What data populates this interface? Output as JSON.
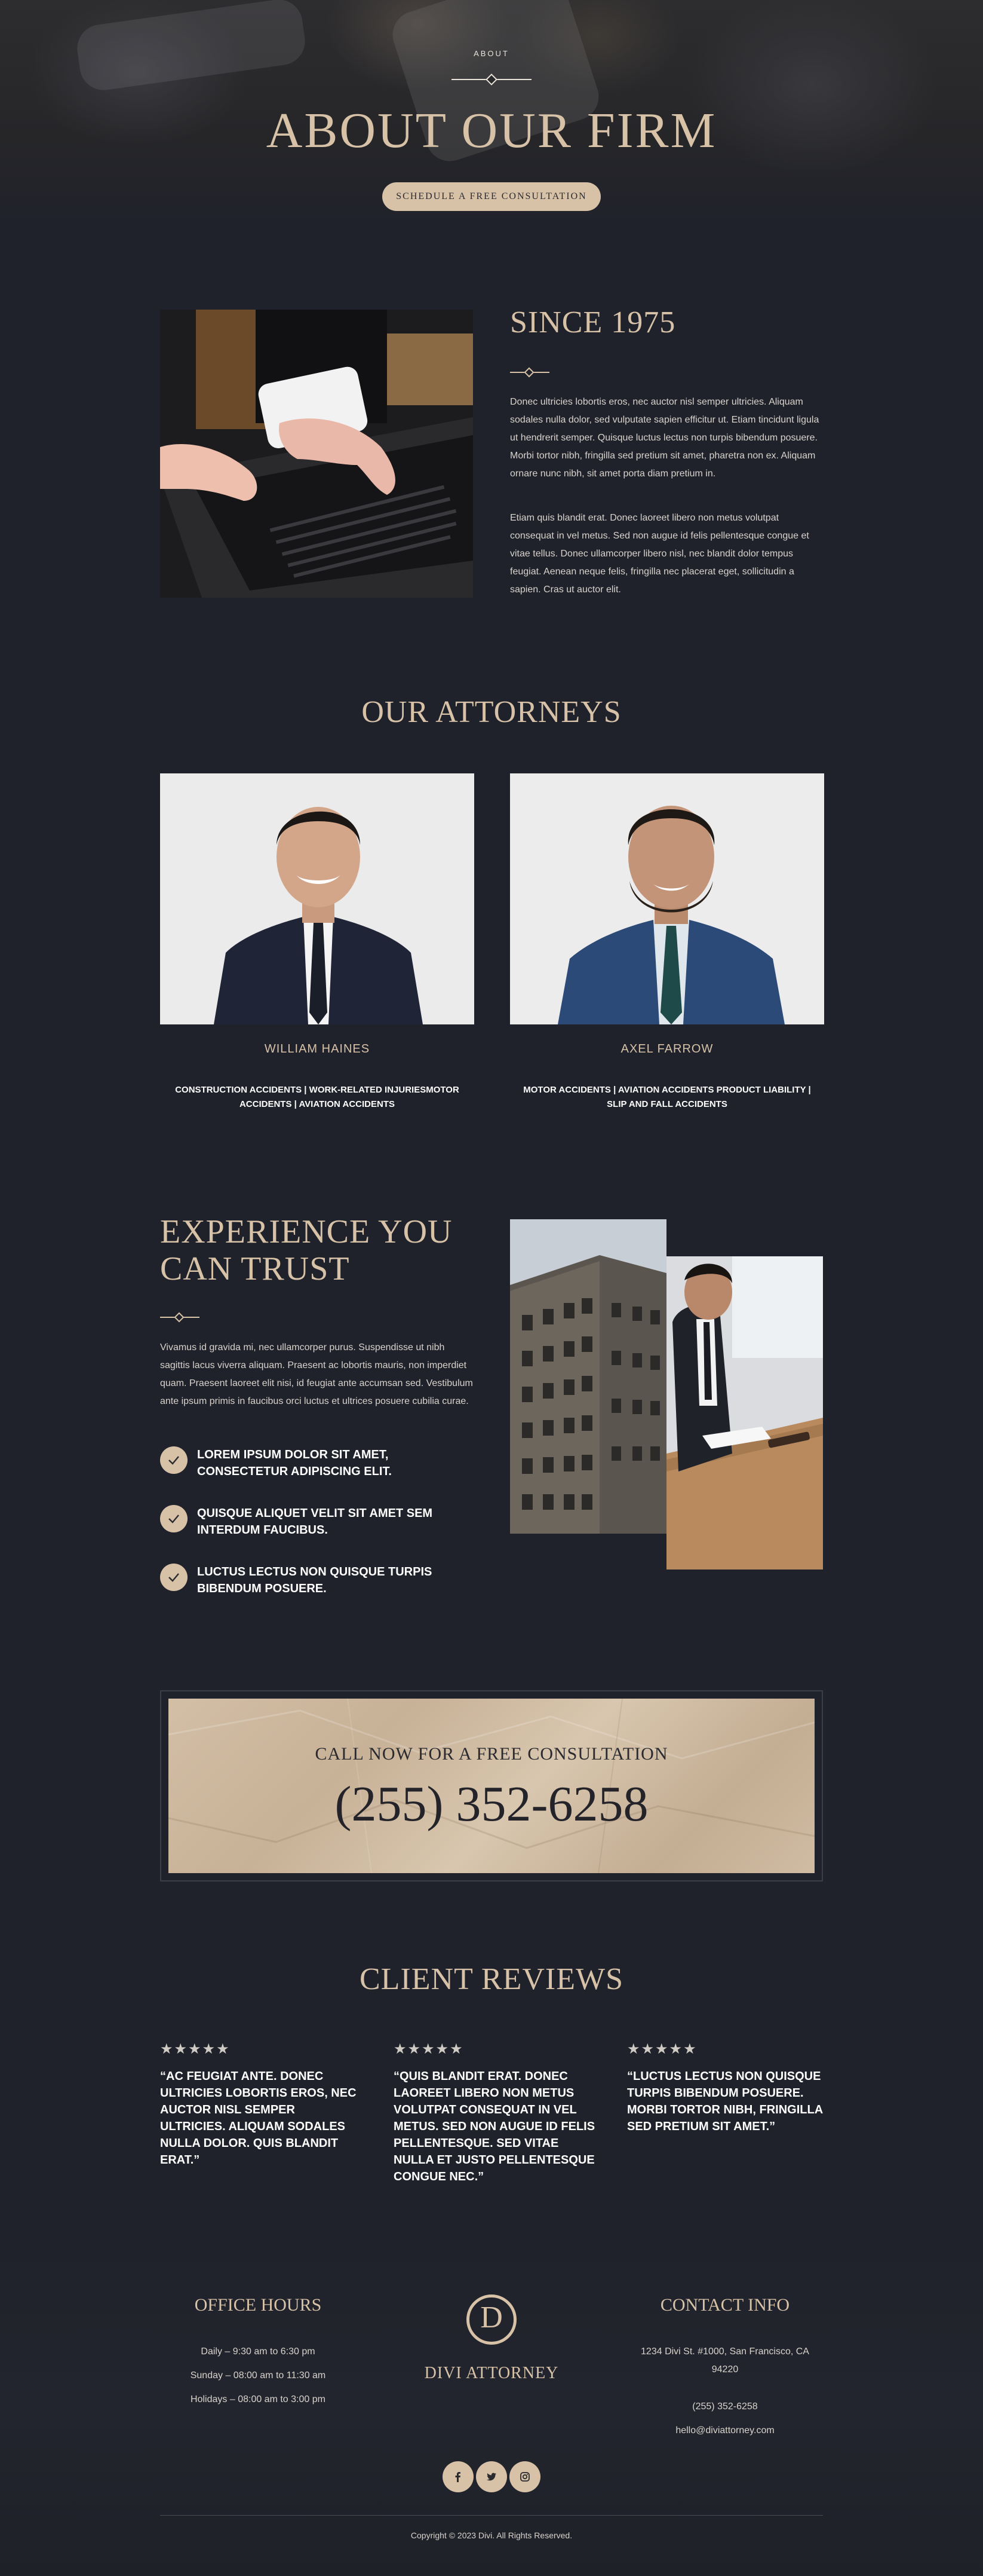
{
  "hero": {
    "eyebrow": "ABOUT",
    "title": "ABOUT OUR FIRM",
    "cta_label": "SCHEDULE A FREE CONSULTATION"
  },
  "since": {
    "title": "SINCE 1975",
    "paragraph1": "Donec ultricies lobortis eros, nec auctor nisl semper ultricies. Aliquam sodales nulla dolor, sed vulputate sapien efficitur ut. Etiam tincidunt ligula ut hendrerit semper. Quisque luctus lectus non turpis bibendum posuere. Morbi tortor nibh, fringilla sed pretium sit amet, pharetra non ex. Aliquam ornare nunc nibh, sit amet porta diam pretium in.",
    "paragraph2": "Etiam quis blandit erat. Donec laoreet libero non metus volutpat consequat in vel metus. Sed non augue id felis pellentesque congue et vitae tellus. Donec ullamcorper libero nisl, nec blandit dolor tempus feugiat. Aenean neque felis, fringilla nec placerat eget, sollicitudin a sapien. Cras ut auctor elit."
  },
  "attorneys": {
    "title": "OUR ATTORNEYS",
    "list": [
      {
        "name": "WILLIAM HAINES",
        "areas": "CONSTRUCTION ACCIDENTS | WORK-RELATED INJURIESMOTOR ACCIDENTS | AVIATION ACCIDENTS"
      },
      {
        "name": "AXEL FARROW",
        "areas": "MOTOR ACCIDENTS | AVIATION ACCIDENTS PRODUCT LIABILITY | SLIP AND FALL ACCIDENTS"
      }
    ]
  },
  "experience": {
    "title": "EXPERIENCE YOU CAN TRUST",
    "paragraph": "Vivamus id gravida mi, nec ullamcorper purus. Suspendisse ut nibh sagittis lacus viverra aliquam. Praesent ac lobortis mauris, non imperdiet quam. Praesent laoreet elit nisi, id feugiat ante accumsan sed. Vestibulum ante ipsum primis in faucibus orci luctus et ultrices posuere cubilia curae.",
    "checklist": [
      "LOREM IPSUM DOLOR SIT AMET, CONSECTETUR ADIPISCING ELIT.",
      "QUISQUE ALIQUET VELIT SIT AMET SEM INTERDUM FAUCIBUS.",
      "LUCTUS LECTUS NON QUISQUE TURPIS BIBENDUM POSUERE."
    ]
  },
  "call": {
    "label": "CALL NOW FOR A FREE CONSULTATION",
    "phone": "(255) 352-6258"
  },
  "reviews": {
    "title": "CLIENT REVIEWS",
    "stars": "★★★★★",
    "items": [
      "“AC FEUGIAT ANTE. DONEC ULTRICIES LOBORTIS EROS, NEC AUCTOR NISL SEMPER ULTRICIES. ALIQUAM SODALES NULLA DOLOR. QUIS BLANDIT ERAT.”",
      "“QUIS BLANDIT ERAT. DONEC LAOREET LIBERO NON METUS VOLUTPAT CONSEQUAT IN VEL METUS. SED NON AUGUE ID FELIS PELLENTESQUE. SED VITAE NULLA ET JUSTO PELLENTESQUE CONGUE NEC.”",
      "“LUCTUS LECTUS NON QUISQUE TURPIS BIBENDUM POSUERE. MORBI TORTOR NIBH, FRINGILLA SED PRETIUM SIT AMET.”"
    ]
  },
  "footer": {
    "hours_title": "OFFICE HOURS",
    "hours": [
      "Daily – 9:30 am to 6:30 pm",
      "Sunday – 08:00 am to 11:30 am",
      "Holidays – 08:00 am to 3:00 pm"
    ],
    "logo_letter": "D",
    "brand": "DIVI ATTORNEY",
    "contact_title": "CONTACT INFO",
    "address": "1234 Divi St. #1000, San Francisco, CA 94220",
    "phone": "(255) 352-6258",
    "email": "hello@diviattorney.com",
    "social": [
      "facebook-icon",
      "twitter-icon",
      "instagram-icon"
    ],
    "copyright": "Copyright © 2023 Divi. All Rights Reserved."
  },
  "colors": {
    "background": "#20222b",
    "accent": "#d7c2a8",
    "text": "#d8d3cc"
  }
}
